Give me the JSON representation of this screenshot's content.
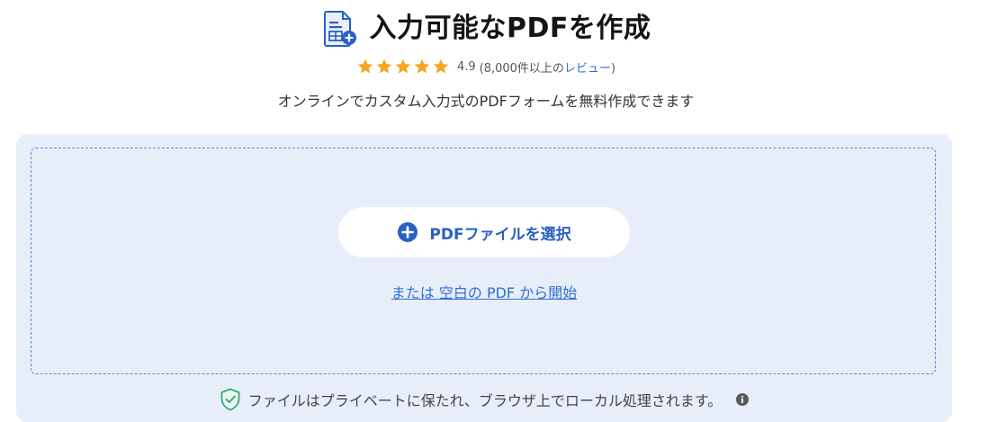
{
  "header": {
    "title": "入力可能なPDFを作成",
    "rating": {
      "stars": 5,
      "score": "4.9",
      "count_text": "(8,000件以上の",
      "reviews_link": "レビュー",
      "close_paren": ")"
    },
    "subtitle": "オンラインでカスタム入力式のPDFフォームを無料作成できます"
  },
  "upload": {
    "select_button_label": "PDFファイルを選択",
    "blank_link_label": "または 空白の PDF から開始",
    "privacy_text": "ファイルはプライベートに保たれ、ブラウザ上でローカル処理されます。"
  },
  "colors": {
    "accent": "#2b5fc4",
    "link": "#2f6fd6",
    "star": "#f5a623",
    "panel_bg": "#e8eef9",
    "shield": "#3aa776"
  }
}
